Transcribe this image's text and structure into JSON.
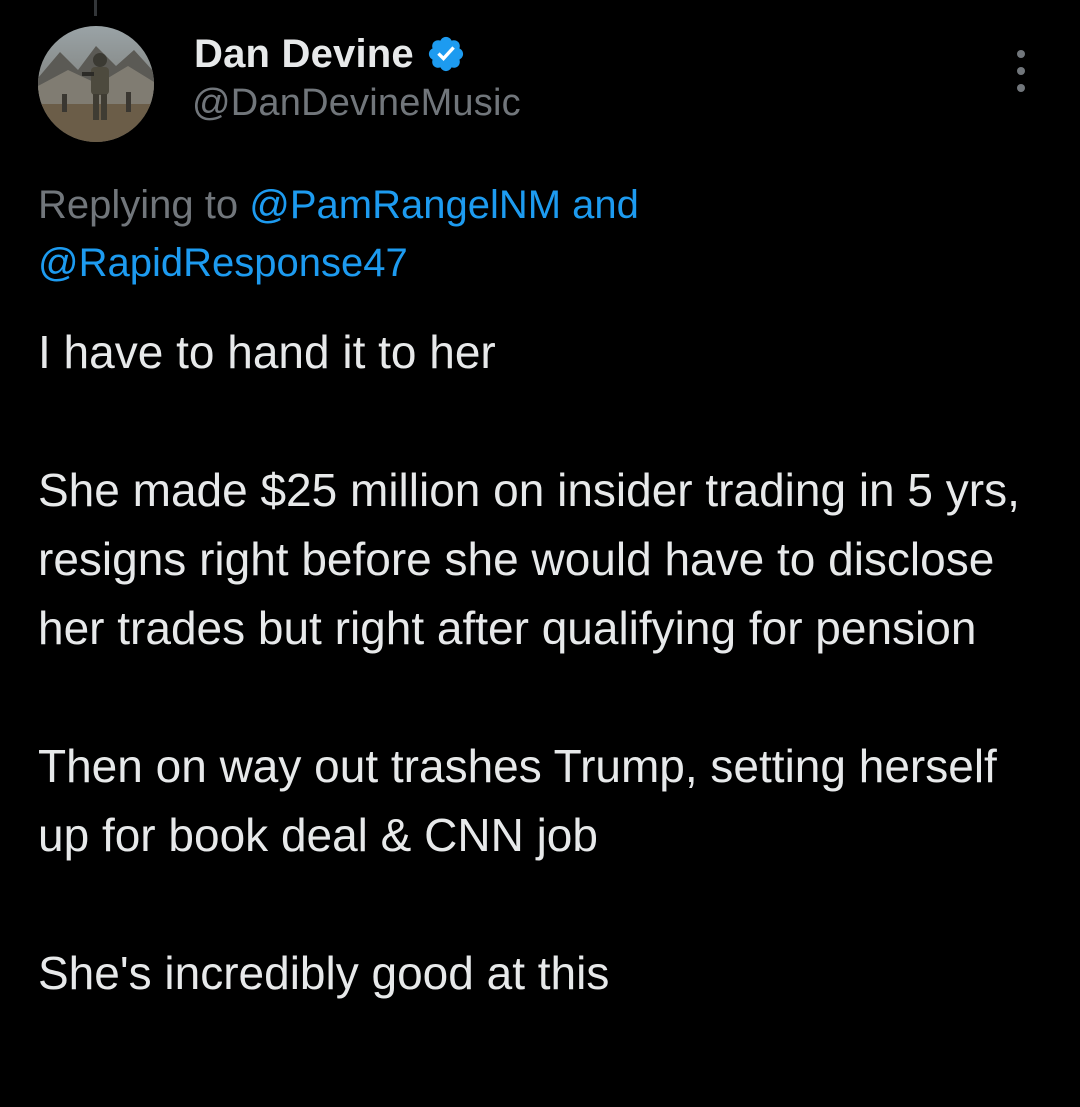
{
  "tweet": {
    "display_name": "Dan Devine",
    "handle": "@DanDevineMusic",
    "verified_icon": "verified-badge-icon",
    "more_icon": "more-options-icon",
    "reply_prefix": "Replying to ",
    "reply_user_1": "@PamRangelNM",
    "reply_and": " and",
    "reply_user_2": "@RapidResponse47",
    "paragraphs": [
      "I have to hand it to her",
      "She made $25 million on insider trading in 5 yrs, resigns right before she would have to disclose her trades but right after qualifying for pension",
      "Then on way out trashes Trump, setting herself up for book deal & CNN job",
      "She's incredibly good at this"
    ]
  },
  "colors": {
    "background": "#000000",
    "primary_text": "#e7e9ea",
    "secondary_text": "#71767b",
    "link": "#1d9bf0",
    "verified": "#1d9bf0"
  }
}
